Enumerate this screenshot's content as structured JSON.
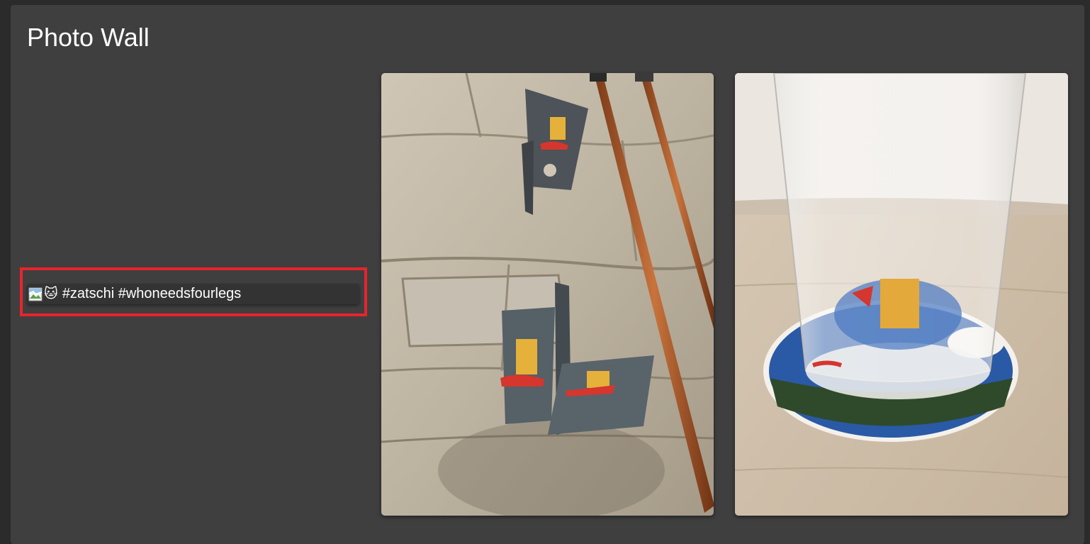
{
  "page": {
    "title": "Photo Wall"
  },
  "cards": [
    {
      "image_state": "broken",
      "emoji": "🐱",
      "caption": "#zatschi #whoneedsfourlegs",
      "highlighted": true
    },
    {
      "image_state": "loaded",
      "subject": "js-stickers-on-wall-brackets"
    },
    {
      "image_state": "loaded",
      "subject": "glass-on-js-coaster"
    }
  ],
  "colors": {
    "page_bg": "#2b2b2b",
    "panel_bg": "#3f3f3f",
    "card_bg": "#333333",
    "highlight": "#e8242c",
    "text": "#ffffff"
  }
}
